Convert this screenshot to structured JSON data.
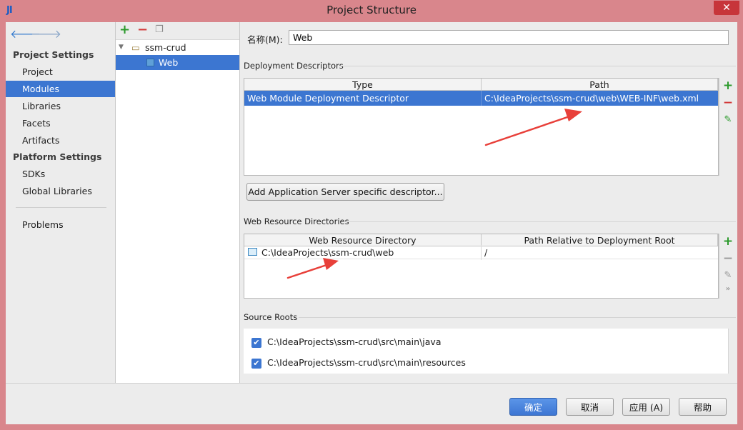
{
  "window": {
    "title": "Project Structure",
    "app_icon_label": "JI",
    "close_symbol": "✕"
  },
  "sidebar": {
    "project_settings_header": "Project Settings",
    "platform_settings_header": "Platform Settings",
    "project_items": [
      "Project",
      "Modules",
      "Libraries",
      "Facets",
      "Artifacts"
    ],
    "platform_items": [
      "SDKs",
      "Global Libraries"
    ],
    "problems": "Problems",
    "selected": "Modules"
  },
  "tree": {
    "root": "ssm-crud",
    "child": "Web",
    "selected": "Web"
  },
  "name_field": {
    "label": "名称(M):",
    "value": "Web"
  },
  "deployment_descriptors": {
    "title": "Deployment Descriptors",
    "columns": [
      "Type",
      "Path"
    ],
    "rows": [
      [
        "Web Module Deployment Descriptor",
        "C:\\IdeaProjects\\ssm-crud\\web\\WEB-INF\\web.xml"
      ]
    ],
    "add_button": "Add Application Server specific descriptor..."
  },
  "web_resources": {
    "title": "Web Resource Directories",
    "columns": [
      "Web Resource Directory",
      "Path Relative to Deployment Root"
    ],
    "rows": [
      [
        "C:\\IdeaProjects\\ssm-crud\\web",
        "/"
      ]
    ]
  },
  "source_roots": {
    "title": "Source Roots",
    "items": [
      "C:\\IdeaProjects\\ssm-crud\\src\\main\\java",
      "C:\\IdeaProjects\\ssm-crud\\src\\main\\resources"
    ]
  },
  "buttons": {
    "ok": "确定",
    "cancel": "取消",
    "apply": "应用 (A)",
    "help": "帮助"
  },
  "colors": {
    "selection": "#3c76d1",
    "window_frame": "#d9868c",
    "annotation_arrow": "#e8403a"
  }
}
